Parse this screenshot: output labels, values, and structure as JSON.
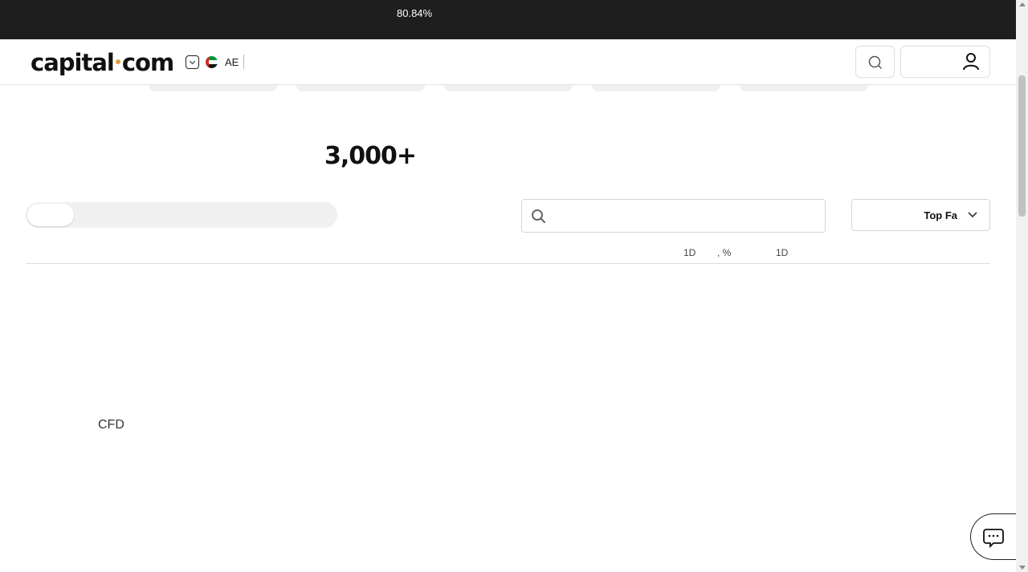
{
  "risk_banner": {
    "text": "80.84%"
  },
  "header": {
    "logo_text_left": "capital",
    "logo_text_right": "com",
    "region_code": "AE"
  },
  "hero": {
    "count": "3,000+"
  },
  "filters": {
    "search_placeholder": "",
    "sort_label": "Top Fa"
  },
  "table": {
    "columns": [
      "1D",
      ", %",
      "1D"
    ]
  },
  "section": {
    "cfd_label": "CFD"
  },
  "colors": {
    "banner_bg": "#1e1e1e",
    "logo_dot": "#e79b3a",
    "toggle_track": "#f0f0f0"
  },
  "icons": [
    "chevron-down-icon",
    "uae-flag-icon",
    "search-icon",
    "user-icon",
    "chat-icon"
  ]
}
